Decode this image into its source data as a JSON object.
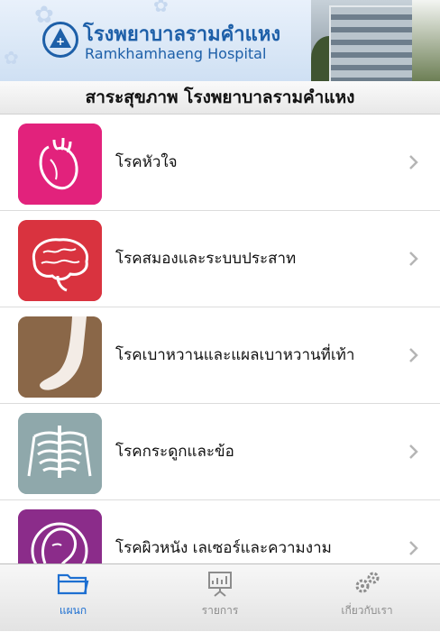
{
  "header": {
    "logo_th": "โรงพยาบาลรามคำแหง",
    "logo_en": "Ramkhamhaeng Hospital",
    "brand_color": "#1d5fa8"
  },
  "page_title": "สาระสุขภาพ โรงพยาบาลรามคำแหง",
  "list": [
    {
      "label": "โรคหัวใจ",
      "icon": "heart-icon",
      "color": "#e2227c"
    },
    {
      "label": "โรคสมองและระบบประสาท",
      "icon": "brain-icon",
      "color": "#d9333f"
    },
    {
      "label": "โรคเบาหวานและแผลเบาหวานที่เท้า",
      "icon": "foot-icon",
      "color": "#8a6748"
    },
    {
      "label": "โรคกระดูกและข้อ",
      "icon": "ribcage-icon",
      "color": "#8fa8ab"
    },
    {
      "label": "โรคผิวหนัง เลเซอร์และความงาม",
      "icon": "woman-face-icon",
      "color": "#8b2c8a"
    }
  ],
  "tabs": [
    {
      "label": "แผนก",
      "icon": "folder-icon",
      "active": true
    },
    {
      "label": "รายการ",
      "icon": "presentation-icon",
      "active": false
    },
    {
      "label": "เกี่ยวกับเรา",
      "icon": "gears-icon",
      "active": false
    }
  ],
  "colors": {
    "active_tab": "#1d6fd1",
    "inactive_tab": "#8c8c8c"
  }
}
